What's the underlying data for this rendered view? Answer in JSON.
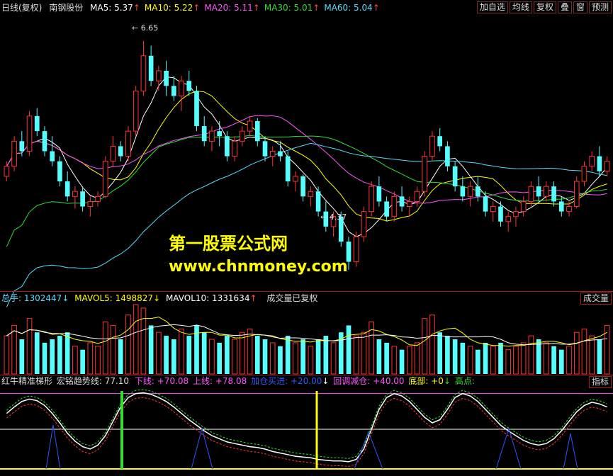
{
  "header": {
    "period": "日线(复权)",
    "stock": "南钢股份",
    "ma": [
      {
        "label": "MA5: 5.37",
        "arrow": "↑",
        "color": "#ffffff"
      },
      {
        "label": "MA10: 5.22",
        "arrow": "↑",
        "color": "#ffff00"
      },
      {
        "label": "MA20: 5.11",
        "arrow": "↑",
        "color": "#ff55ff"
      },
      {
        "label": "MA30: 5.01",
        "arrow": "↑",
        "color": "#33dd33"
      },
      {
        "label": "MA60: 5.04",
        "arrow": "↑",
        "color": "#55ddff"
      }
    ],
    "buttons": [
      "加自选",
      "均线",
      "复权",
      "叠",
      "窗",
      "预测"
    ]
  },
  "price_annotations": {
    "high": "6.65",
    "low": "4.37"
  },
  "watermark": {
    "line1": "第一股票公式网",
    "line2": "www.chnmoney.com"
  },
  "volume_header": {
    "total": "总手: 1302447",
    "total_arrow": "↓",
    "mavol5": "MAVOL5: 1498827",
    "mavol5_arrow": "↓",
    "mavol10": "MAVOL10: 1331634",
    "mavol10_arrow": "↑",
    "note": "成交量已复权",
    "right_button": "成交量"
  },
  "indicator_header": {
    "name": "红牛精准梯形",
    "trend": "宏铭趋势线: 77.10",
    "lower": "下线: +70.08",
    "upper": "上线: +78.08",
    "buy": "加仓买进: +20.00",
    "sell": "回调减仓: +40.00",
    "bottom": "底部: +0",
    "high": "高点:",
    "right_button": "指标"
  },
  "colors": {
    "up": "#ff3333",
    "down": "#55ffff",
    "border": "#a02020"
  },
  "chart_data": {
    "type": "candlestick",
    "title": "南钢股份",
    "price_range": [
      4.2,
      6.9
    ],
    "candles": [
      [
        5.3,
        5.45,
        5.25,
        5.4
      ],
      [
        5.4,
        5.7,
        5.35,
        5.65
      ],
      [
        5.65,
        5.75,
        5.5,
        5.55
      ],
      [
        5.55,
        5.95,
        5.5,
        5.9
      ],
      [
        5.9,
        5.98,
        5.7,
        5.75
      ],
      [
        5.75,
        5.8,
        5.5,
        5.55
      ],
      [
        5.55,
        5.7,
        5.4,
        5.45
      ],
      [
        5.45,
        5.5,
        5.2,
        5.25
      ],
      [
        5.25,
        5.35,
        5.05,
        5.1
      ],
      [
        5.1,
        5.2,
        4.98,
        5.15
      ],
      [
        5.15,
        5.2,
        4.95,
        5.0
      ],
      [
        5.0,
        5.1,
        4.9,
        5.05
      ],
      [
        5.05,
        5.15,
        5.0,
        5.1
      ],
      [
        5.1,
        5.5,
        5.08,
        5.45
      ],
      [
        5.45,
        5.7,
        5.4,
        5.6
      ],
      [
        5.6,
        5.65,
        5.45,
        5.5
      ],
      [
        5.5,
        5.8,
        5.45,
        5.75
      ],
      [
        5.75,
        6.2,
        5.7,
        6.15
      ],
      [
        6.15,
        6.65,
        6.1,
        6.5
      ],
      [
        6.5,
        6.6,
        6.2,
        6.25
      ],
      [
        6.25,
        6.4,
        6.15,
        6.35
      ],
      [
        6.35,
        6.45,
        6.1,
        6.2
      ],
      [
        6.2,
        6.3,
        6.05,
        6.1
      ],
      [
        6.1,
        6.3,
        5.95,
        6.25
      ],
      [
        6.25,
        6.35,
        6.1,
        6.15
      ],
      [
        6.15,
        6.2,
        5.75,
        5.8
      ],
      [
        5.8,
        5.9,
        5.6,
        5.65
      ],
      [
        5.65,
        5.8,
        5.55,
        5.75
      ],
      [
        5.75,
        5.85,
        5.6,
        5.7
      ],
      [
        5.7,
        5.75,
        5.45,
        5.5
      ],
      [
        5.5,
        5.7,
        5.45,
        5.65
      ],
      [
        5.65,
        5.8,
        5.6,
        5.75
      ],
      [
        5.75,
        5.9,
        5.7,
        5.85
      ],
      [
        5.85,
        5.88,
        5.6,
        5.65
      ],
      [
        5.65,
        5.7,
        5.45,
        5.5
      ],
      [
        5.5,
        5.6,
        5.4,
        5.55
      ],
      [
        5.55,
        5.65,
        5.45,
        5.5
      ],
      [
        5.5,
        5.55,
        5.2,
        5.25
      ],
      [
        5.25,
        5.35,
        5.15,
        5.3
      ],
      [
        5.3,
        5.32,
        5.05,
        5.1
      ],
      [
        5.1,
        5.2,
        5.0,
        5.15
      ],
      [
        5.15,
        5.2,
        4.9,
        4.95
      ],
      [
        4.95,
        5.05,
        4.75,
        4.8
      ],
      [
        4.8,
        4.95,
        4.7,
        4.9
      ],
      [
        4.9,
        4.95,
        4.6,
        4.65
      ],
      [
        4.65,
        4.7,
        4.37,
        4.45
      ],
      [
        4.45,
        4.75,
        4.4,
        4.7
      ],
      [
        4.7,
        5.0,
        4.65,
        4.95
      ],
      [
        4.95,
        5.25,
        4.9,
        5.2
      ],
      [
        5.2,
        5.3,
        5.0,
        5.05
      ],
      [
        5.05,
        5.1,
        4.85,
        4.9
      ],
      [
        4.9,
        5.15,
        4.85,
        5.1
      ],
      [
        5.1,
        5.2,
        4.95,
        5.0
      ],
      [
        5.0,
        5.1,
        4.9,
        5.05
      ],
      [
        5.05,
        5.2,
        5.0,
        5.15
      ],
      [
        5.15,
        5.55,
        5.1,
        5.5
      ],
      [
        5.5,
        5.75,
        5.45,
        5.7
      ],
      [
        5.7,
        5.78,
        5.55,
        5.6
      ],
      [
        5.6,
        5.65,
        5.35,
        5.4
      ],
      [
        5.4,
        5.45,
        5.15,
        5.2
      ],
      [
        5.2,
        5.3,
        5.05,
        5.1
      ],
      [
        5.1,
        5.25,
        5.0,
        5.2
      ],
      [
        5.2,
        5.3,
        5.05,
        5.1
      ],
      [
        5.1,
        5.15,
        4.9,
        4.95
      ],
      [
        4.95,
        5.05,
        4.85,
        5.0
      ],
      [
        5.0,
        5.05,
        4.8,
        4.85
      ],
      [
        4.85,
        4.95,
        4.75,
        4.9
      ],
      [
        4.9,
        5.0,
        4.8,
        4.95
      ],
      [
        4.95,
        5.1,
        4.9,
        5.05
      ],
      [
        5.05,
        5.25,
        5.0,
        5.2
      ],
      [
        5.2,
        5.3,
        5.05,
        5.1
      ],
      [
        5.1,
        5.25,
        5.05,
        5.2
      ],
      [
        5.2,
        5.25,
        5.0,
        5.05
      ],
      [
        5.05,
        5.1,
        4.9,
        4.95
      ],
      [
        4.95,
        5.05,
        4.9,
        5.0
      ],
      [
        5.0,
        5.3,
        4.98,
        5.25
      ],
      [
        5.25,
        5.45,
        5.2,
        5.4
      ],
      [
        5.4,
        5.55,
        5.35,
        5.5
      ],
      [
        5.5,
        5.6,
        5.3,
        5.35
      ],
      [
        5.35,
        5.5,
        5.3,
        5.45
      ]
    ],
    "volume": [
      0.55,
      0.7,
      0.5,
      0.8,
      0.6,
      0.45,
      0.5,
      0.55,
      0.6,
      0.4,
      0.35,
      0.45,
      0.4,
      0.75,
      0.7,
      0.5,
      0.85,
      1.0,
      0.95,
      0.7,
      0.6,
      0.55,
      0.5,
      0.65,
      0.55,
      0.7,
      0.6,
      0.5,
      0.45,
      0.55,
      0.5,
      0.6,
      0.65,
      0.55,
      0.5,
      0.45,
      0.4,
      0.55,
      0.45,
      0.5,
      0.4,
      0.5,
      0.55,
      0.45,
      0.6,
      0.7,
      0.55,
      0.6,
      0.75,
      0.5,
      0.45,
      0.4,
      0.35,
      0.4,
      0.45,
      0.8,
      0.85,
      0.6,
      0.55,
      0.5,
      0.45,
      0.4,
      0.35,
      0.45,
      0.4,
      0.45,
      0.35,
      0.4,
      0.45,
      0.55,
      0.5,
      0.45,
      0.4,
      0.35,
      0.4,
      0.6,
      0.65,
      0.55,
      0.5,
      0.7
    ],
    "indicator": [
      70,
      78,
      85,
      88,
      86,
      80,
      70,
      58,
      45,
      35,
      28,
      25,
      30,
      42,
      60,
      78,
      90,
      95,
      96,
      94,
      90,
      85,
      78,
      70,
      62,
      55,
      48,
      42,
      38,
      34,
      32,
      30,
      28,
      27,
      25,
      22,
      20,
      18,
      16,
      15,
      14,
      12,
      11,
      10,
      10,
      9,
      12,
      25,
      50,
      75,
      90,
      95,
      92,
      85,
      75,
      65,
      58,
      62,
      75,
      90,
      95,
      92,
      85,
      75,
      65,
      55,
      48,
      42,
      36,
      32,
      30,
      32,
      38,
      48,
      60,
      72,
      80,
      84,
      82,
      78
    ]
  }
}
